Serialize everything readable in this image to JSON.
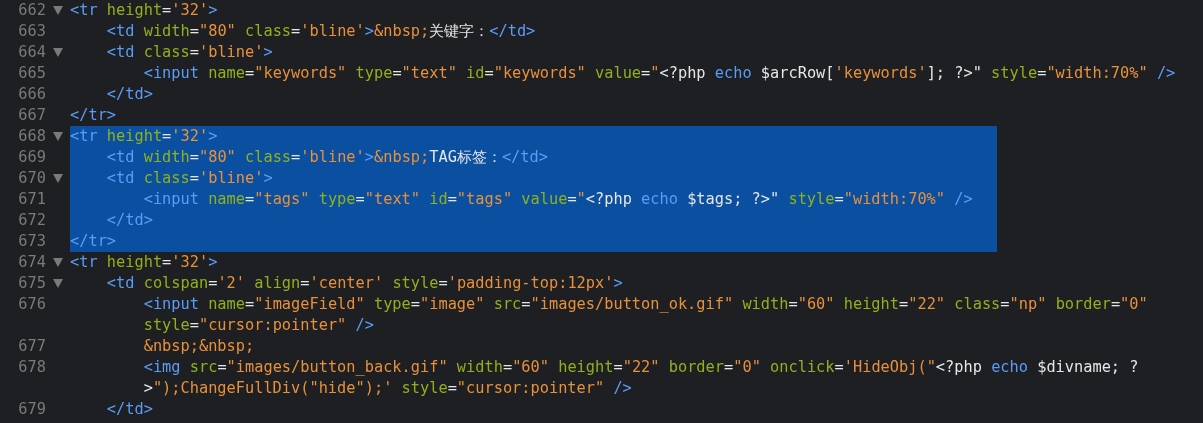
{
  "editor": {
    "lines": [
      {
        "number": "662",
        "foldable": true,
        "selected": false,
        "tokens": [
          {
            "kind": "tag",
            "text": "<tr "
          },
          {
            "kind": "attr",
            "text": "height"
          },
          {
            "kind": "plain",
            "text": "="
          },
          {
            "kind": "string",
            "text": "'32'"
          },
          {
            "kind": "tag",
            "text": ">"
          }
        ]
      },
      {
        "number": "663",
        "foldable": false,
        "selected": false,
        "tokens": [
          {
            "kind": "tag",
            "text": "    <td "
          },
          {
            "kind": "attr",
            "text": "width"
          },
          {
            "kind": "plain",
            "text": "="
          },
          {
            "kind": "string",
            "text": "\"80\" "
          },
          {
            "kind": "attr",
            "text": "class"
          },
          {
            "kind": "plain",
            "text": "="
          },
          {
            "kind": "string",
            "text": "'bline'"
          },
          {
            "kind": "tag",
            "text": ">"
          },
          {
            "kind": "string",
            "text": "&nbsp;"
          },
          {
            "kind": "plain",
            "text": "关键字："
          },
          {
            "kind": "tag",
            "text": "</td>"
          }
        ]
      },
      {
        "number": "664",
        "foldable": true,
        "selected": false,
        "tokens": [
          {
            "kind": "tag",
            "text": "    <td "
          },
          {
            "kind": "attr",
            "text": "class"
          },
          {
            "kind": "plain",
            "text": "="
          },
          {
            "kind": "string",
            "text": "'bline'"
          },
          {
            "kind": "tag",
            "text": ">"
          }
        ]
      },
      {
        "number": "665",
        "foldable": false,
        "selected": false,
        "tokens": [
          {
            "kind": "tag",
            "text": "        <input "
          },
          {
            "kind": "attr",
            "text": "name"
          },
          {
            "kind": "plain",
            "text": "="
          },
          {
            "kind": "string",
            "text": "\"keywords\" "
          },
          {
            "kind": "attr",
            "text": "type"
          },
          {
            "kind": "plain",
            "text": "="
          },
          {
            "kind": "string",
            "text": "\"text\" "
          },
          {
            "kind": "attr",
            "text": "id"
          },
          {
            "kind": "plain",
            "text": "="
          },
          {
            "kind": "string",
            "text": "\"keywords\" "
          },
          {
            "kind": "attr",
            "text": "value"
          },
          {
            "kind": "plain",
            "text": "="
          },
          {
            "kind": "string",
            "text": "\""
          },
          {
            "kind": "plain",
            "text": "<?php "
          },
          {
            "kind": "keyword",
            "text": "echo"
          },
          {
            "kind": "plain",
            "text": " $arcRow["
          },
          {
            "kind": "string",
            "text": "'keywords'"
          },
          {
            "kind": "plain",
            "text": "]; ?>\" "
          },
          {
            "kind": "attr",
            "text": "style"
          },
          {
            "kind": "plain",
            "text": "="
          },
          {
            "kind": "string",
            "text": "\"width:70%\" "
          },
          {
            "kind": "tag",
            "text": "/>"
          }
        ]
      },
      {
        "number": "666",
        "foldable": false,
        "selected": false,
        "tokens": [
          {
            "kind": "tag",
            "text": "    </td>"
          }
        ]
      },
      {
        "number": "667",
        "foldable": false,
        "selected": false,
        "tokens": [
          {
            "kind": "tag",
            "text": "</tr>"
          }
        ]
      },
      {
        "number": "668",
        "foldable": true,
        "selected": true,
        "tokens": [
          {
            "kind": "tag",
            "text": "<tr "
          },
          {
            "kind": "attr",
            "text": "height"
          },
          {
            "kind": "plain",
            "text": "="
          },
          {
            "kind": "string",
            "text": "'32'"
          },
          {
            "kind": "tag",
            "text": ">"
          }
        ]
      },
      {
        "number": "669",
        "foldable": false,
        "selected": true,
        "tokens": [
          {
            "kind": "tag",
            "text": "    <td "
          },
          {
            "kind": "attr",
            "text": "width"
          },
          {
            "kind": "plain",
            "text": "="
          },
          {
            "kind": "string",
            "text": "\"80\" "
          },
          {
            "kind": "attr",
            "text": "class"
          },
          {
            "kind": "plain",
            "text": "="
          },
          {
            "kind": "string",
            "text": "'bline'"
          },
          {
            "kind": "tag",
            "text": ">"
          },
          {
            "kind": "string",
            "text": "&nbsp;"
          },
          {
            "kind": "plain",
            "text": "TAG标签："
          },
          {
            "kind": "tag",
            "text": "</td>"
          }
        ]
      },
      {
        "number": "670",
        "foldable": true,
        "selected": true,
        "tokens": [
          {
            "kind": "tag",
            "text": "    <td "
          },
          {
            "kind": "attr",
            "text": "class"
          },
          {
            "kind": "plain",
            "text": "="
          },
          {
            "kind": "string",
            "text": "'bline'"
          },
          {
            "kind": "tag",
            "text": ">"
          }
        ]
      },
      {
        "number": "671",
        "foldable": false,
        "selected": true,
        "tokens": [
          {
            "kind": "tag",
            "text": "        <input "
          },
          {
            "kind": "attr",
            "text": "name"
          },
          {
            "kind": "plain",
            "text": "="
          },
          {
            "kind": "string",
            "text": "\"tags\" "
          },
          {
            "kind": "attr",
            "text": "type"
          },
          {
            "kind": "plain",
            "text": "="
          },
          {
            "kind": "string",
            "text": "\"text\" "
          },
          {
            "kind": "attr",
            "text": "id"
          },
          {
            "kind": "plain",
            "text": "="
          },
          {
            "kind": "string",
            "text": "\"tags\" "
          },
          {
            "kind": "attr",
            "text": "value"
          },
          {
            "kind": "plain",
            "text": "="
          },
          {
            "kind": "string",
            "text": "\""
          },
          {
            "kind": "plain",
            "text": "<?php "
          },
          {
            "kind": "keyword",
            "text": "echo"
          },
          {
            "kind": "plain",
            "text": " $tags; ?>\" "
          },
          {
            "kind": "attr",
            "text": "style"
          },
          {
            "kind": "plain",
            "text": "="
          },
          {
            "kind": "string",
            "text": "\"width:70%\" "
          },
          {
            "kind": "tag",
            "text": "/>"
          }
        ]
      },
      {
        "number": "672",
        "foldable": false,
        "selected": true,
        "tokens": [
          {
            "kind": "tag",
            "text": "    </td>"
          }
        ]
      },
      {
        "number": "673",
        "foldable": false,
        "selected": true,
        "tokens": [
          {
            "kind": "tag",
            "text": "</tr>"
          }
        ]
      },
      {
        "number": "674",
        "foldable": true,
        "selected": false,
        "tokens": [
          {
            "kind": "tag",
            "text": "<tr "
          },
          {
            "kind": "attr",
            "text": "height"
          },
          {
            "kind": "plain",
            "text": "="
          },
          {
            "kind": "string",
            "text": "'32'"
          },
          {
            "kind": "tag",
            "text": ">"
          }
        ]
      },
      {
        "number": "675",
        "foldable": true,
        "selected": false,
        "tokens": [
          {
            "kind": "tag",
            "text": "    <td "
          },
          {
            "kind": "attr",
            "text": "colspan"
          },
          {
            "kind": "plain",
            "text": "="
          },
          {
            "kind": "string",
            "text": "'2' "
          },
          {
            "kind": "attr",
            "text": "align"
          },
          {
            "kind": "plain",
            "text": "="
          },
          {
            "kind": "string",
            "text": "'center' "
          },
          {
            "kind": "attr",
            "text": "style"
          },
          {
            "kind": "plain",
            "text": "="
          },
          {
            "kind": "string",
            "text": "'padding-top:12px'"
          },
          {
            "kind": "tag",
            "text": ">"
          }
        ]
      },
      {
        "number": "676",
        "foldable": false,
        "selected": false,
        "tokens": [
          {
            "kind": "tag",
            "text": "        <input "
          },
          {
            "kind": "attr",
            "text": "name"
          },
          {
            "kind": "plain",
            "text": "="
          },
          {
            "kind": "string",
            "text": "\"imageField\" "
          },
          {
            "kind": "attr",
            "text": "type"
          },
          {
            "kind": "plain",
            "text": "="
          },
          {
            "kind": "string",
            "text": "\"image\" "
          },
          {
            "kind": "attr",
            "text": "src"
          },
          {
            "kind": "plain",
            "text": "="
          },
          {
            "kind": "string",
            "text": "\"images/button_ok.gif\" "
          },
          {
            "kind": "attr",
            "text": "width"
          },
          {
            "kind": "plain",
            "text": "="
          },
          {
            "kind": "string",
            "text": "\"60\" "
          },
          {
            "kind": "attr",
            "text": "height"
          },
          {
            "kind": "plain",
            "text": "="
          },
          {
            "kind": "string",
            "text": "\"22\" "
          },
          {
            "kind": "attr",
            "text": "class"
          },
          {
            "kind": "plain",
            "text": "="
          },
          {
            "kind": "string",
            "text": "\"np\" "
          },
          {
            "kind": "attr",
            "text": "border"
          },
          {
            "kind": "plain",
            "text": "="
          },
          {
            "kind": "string",
            "text": "\"0\""
          }
        ]
      },
      {
        "foldable": false,
        "selected": false,
        "tokens": [
          {
            "kind": "attr",
            "text": "        style"
          },
          {
            "kind": "plain",
            "text": "="
          },
          {
            "kind": "string",
            "text": "\"cursor:pointer\" "
          },
          {
            "kind": "tag",
            "text": "/>"
          }
        ]
      },
      {
        "number": "677",
        "foldable": false,
        "selected": false,
        "tokens": [
          {
            "kind": "string",
            "text": "        &nbsp;&nbsp;"
          }
        ]
      },
      {
        "number": "678",
        "foldable": false,
        "selected": false,
        "tokens": [
          {
            "kind": "tag",
            "text": "        <img "
          },
          {
            "kind": "attr",
            "text": "src"
          },
          {
            "kind": "plain",
            "text": "="
          },
          {
            "kind": "string",
            "text": "\"images/button_back.gif\" "
          },
          {
            "kind": "attr",
            "text": "width"
          },
          {
            "kind": "plain",
            "text": "="
          },
          {
            "kind": "string",
            "text": "\"60\" "
          },
          {
            "kind": "attr",
            "text": "height"
          },
          {
            "kind": "plain",
            "text": "="
          },
          {
            "kind": "string",
            "text": "\"22\" "
          },
          {
            "kind": "attr",
            "text": "border"
          },
          {
            "kind": "plain",
            "text": "="
          },
          {
            "kind": "string",
            "text": "\"0\" "
          },
          {
            "kind": "attr",
            "text": "onclick"
          },
          {
            "kind": "plain",
            "text": "="
          },
          {
            "kind": "string",
            "text": "'HideObj(\""
          },
          {
            "kind": "plain",
            "text": "<?php "
          },
          {
            "kind": "keyword",
            "text": "echo"
          },
          {
            "kind": "plain",
            "text": " $divname; ?"
          }
        ]
      },
      {
        "foldable": false,
        "selected": false,
        "tokens": [
          {
            "kind": "plain",
            "text": "        >"
          },
          {
            "kind": "string",
            "text": "\");ChangeFullDiv(\"hide\");' "
          },
          {
            "kind": "attr",
            "text": "style"
          },
          {
            "kind": "plain",
            "text": "="
          },
          {
            "kind": "string",
            "text": "\"cursor:pointer\" "
          },
          {
            "kind": "tag",
            "text": "/>"
          }
        ]
      },
      {
        "number": "679",
        "foldable": false,
        "selected": false,
        "tokens": [
          {
            "kind": "tag",
            "text": "    </td>"
          }
        ]
      }
    ]
  }
}
